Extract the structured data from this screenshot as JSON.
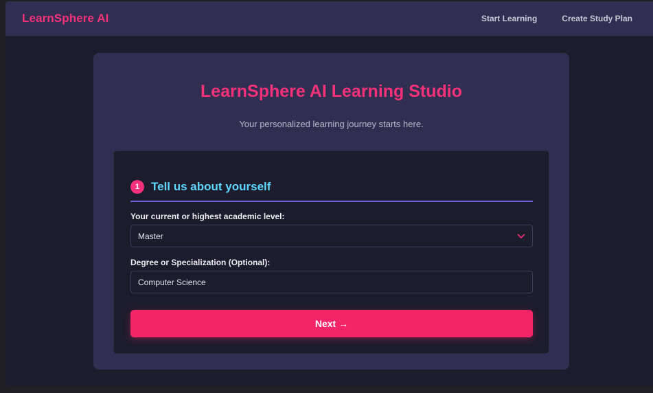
{
  "navbar": {
    "brand": "LearnSphere AI",
    "links": [
      {
        "label": "Start Learning"
      },
      {
        "label": "Create Study Plan"
      }
    ]
  },
  "studio": {
    "title": "LearnSphere AI Learning Studio",
    "subtitle": "Your personalized learning journey starts here."
  },
  "step": {
    "number": "1",
    "title": "Tell us about yourself"
  },
  "form": {
    "academic_level": {
      "label": "Your current or highest academic level:",
      "selected": "Master"
    },
    "degree": {
      "label": "Degree or Specialization (Optional):",
      "value": "Computer Science"
    },
    "next_label": "Next →"
  },
  "colors": {
    "accent": "#f5317a",
    "step_title": "#5ed7ff",
    "divider": "#6b5fd6",
    "card": "#302f51",
    "panel": "#1d1c2c"
  },
  "icons": {
    "select": "chevron-down-icon"
  }
}
